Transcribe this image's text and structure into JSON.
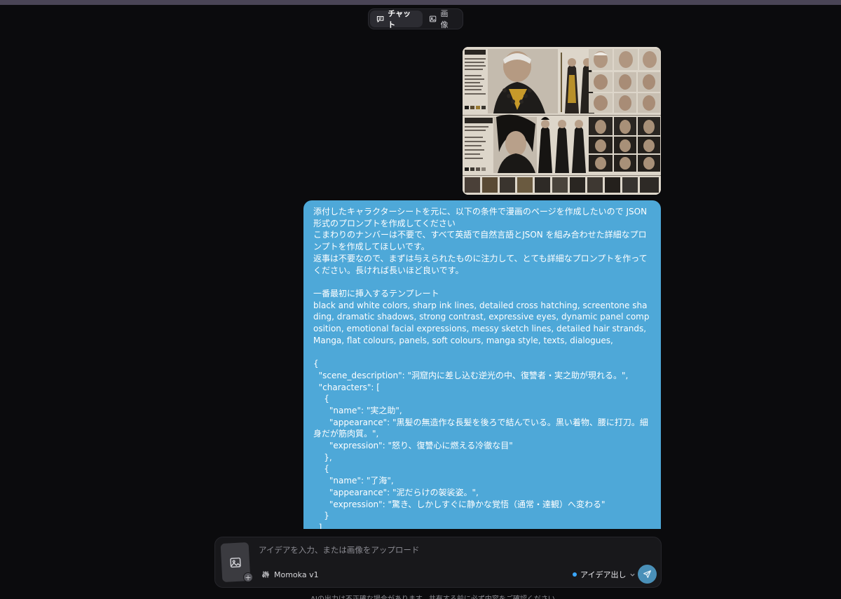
{
  "mode_toggle": {
    "chat_label": "チャット",
    "image_label": "画像"
  },
  "message": {
    "text": "添付したキャラクターシートを元に、以下の条件で漫画のページを作成したいので JSON形式のプロンプトを作成してください\nこまわりのナンバーは不要で、すべて英語で自然言語とJSON を組み合わせた詳細なプロンプトを作成してほしいです。\n返事は不要なので、まずは与えられたものに注力して、とても詳細なプロンプトを作ってください。長ければ長いほど良いです。\n\n一番最初に挿入するテンプレート\nblack and white colors, sharp ink lines, detailed cross hatching, screentone shading, dramatic shadows, strong contrast, expressive eyes, dynamic panel composition, emotional facial expressions, messy sketch lines, detailed hair strands,Manga, flat colours, panels, soft colours, manga style, texts, dialogues,\n\n{\n  \"scene_description\": \"洞窟内に差し込む逆光の中、復讐者・実之助が現れる。\",\n  \"characters\": [\n    {\n      \"name\": \"実之助\",\n      \"appearance\": \"黒髪の無造作な長髪を後ろで結んでいる。黒い着物、腰に打刀。細身だが筋肉質。\",\n      \"expression\": \"怒り、復讐心に燃える冷徹な目\"\n    },\n    {\n      \"name\": \"了海\",\n      \"appearance\": \"泥だらけの袈裟姿。\",\n      \"expression\": \"驚き、しかしすぐに静かな覚悟（通常・達観）へ変わる\"\n    }\n  ],"
  },
  "composer": {
    "placeholder": "アイデアを入力、または画像をアップロード",
    "model_label": "Momoka v1",
    "mode_label": "アイデア出し"
  },
  "disclaimer": "AIの出力は不正確な場合があります。共有する前に必ず内容をご確認ください。",
  "colors": {
    "background": "#0b0b0d",
    "bubble": "#4ea8d8",
    "accent_dot": "#3aa7ff",
    "send_button": "#4a90b8"
  },
  "icons": [
    "chat-icon",
    "image-icon",
    "settings-sliders-icon",
    "chevron-down-icon",
    "send-icon",
    "plus-icon"
  ]
}
